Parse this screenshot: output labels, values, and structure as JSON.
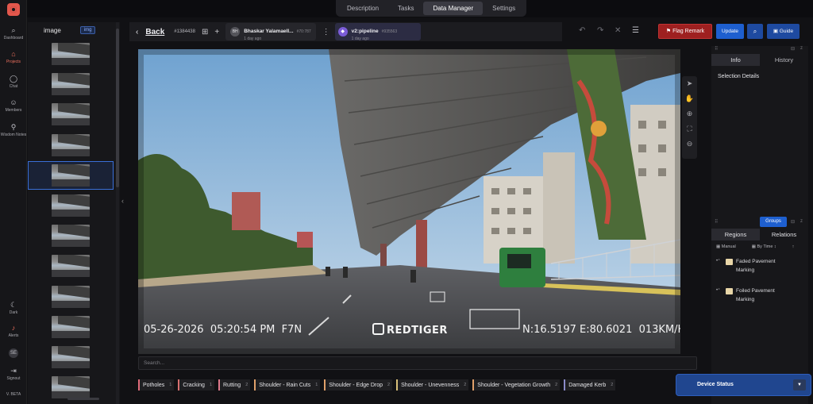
{
  "tabs": [
    "Description",
    "Tasks",
    "Data Manager",
    "Settings"
  ],
  "rail": {
    "top": [
      {
        "label": "Dashboard",
        "icon": "search-icon"
      },
      {
        "label": "Projects",
        "icon": "home-icon"
      },
      {
        "label": "Chat",
        "icon": "chat-icon"
      },
      {
        "label": "Members",
        "icon": "members-icon"
      },
      {
        "label": "Wisdom Notes",
        "icon": "notes-icon"
      }
    ],
    "bottom": [
      {
        "label": "Dark",
        "icon": "moon-icon"
      },
      {
        "label": "Alerts",
        "icon": "bell-icon"
      },
      {
        "label": "SE",
        "icon": "avatar-icon"
      },
      {
        "label": "Signout",
        "icon": "signout-icon"
      }
    ],
    "version": "V. BETA"
  },
  "thumbnails": {
    "header": "image",
    "badge": "img",
    "count": 12,
    "selected_index": 4
  },
  "editor": {
    "back_label": "Back",
    "task_id": "#1384438",
    "annotator": {
      "initials": "BH",
      "name": "Bhaskar Yalamaell...",
      "id": "#70:787",
      "time": "1 day ago"
    },
    "pipeline": {
      "initials": "",
      "name": "v2:pipeline",
      "id": "#935563",
      "time": "1 day ago"
    },
    "flag_label": "Flag Remark",
    "update_label": "Update",
    "guide_label": "Guide"
  },
  "overlay": {
    "datetime": "05-26-2026  05:20:54 PM  F7N",
    "brand": "REDTIGER",
    "gps": "N:16.5197 E:80.6021  013KM/H"
  },
  "canvas_search": {
    "placeholder": "Search..."
  },
  "labels": [
    {
      "name": "Potholes",
      "count": "1",
      "color": "#e06b7a"
    },
    {
      "name": "Cracking",
      "count": "1",
      "color": "#d87070"
    },
    {
      "name": "Rutting",
      "count": "2",
      "color": "#e07a8c"
    },
    {
      "name": "Shoulder - Rain Cuts",
      "count": "1",
      "color": "#e0a06a"
    },
    {
      "name": "Shoulder - Edge Drop",
      "count": "2",
      "color": "#e0a06a"
    },
    {
      "name": "Shoulder - Unevenness",
      "count": "2",
      "color": "#d8c07a"
    },
    {
      "name": "Shoulder - Vegetation Growth",
      "count": "2",
      "color": "#e0a06a"
    },
    {
      "name": "Damaged Kerb",
      "count": "2",
      "color": "#8a8ac8"
    }
  ],
  "right_panel": {
    "tabs": [
      "Info",
      "History"
    ],
    "selection_title": "Selection Details",
    "groups_label": "Groups",
    "region_tabs": [
      "Regions",
      "Relations"
    ],
    "tools": [
      "Manual",
      "By Time ↕"
    ],
    "regions": [
      {
        "label": "Faded Pavement Marking",
        "color": "#e8d6a8"
      },
      {
        "label": "Foiled Pavement Marking",
        "color": "#e8d6a8"
      }
    ]
  },
  "device_status": "Device Status"
}
